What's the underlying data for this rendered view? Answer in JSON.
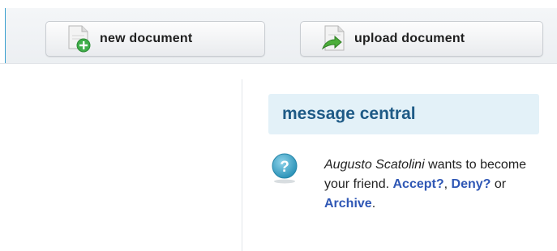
{
  "toolbar": {
    "new_document_label": "new document",
    "new_document_icon": "new-document-icon",
    "upload_document_label": "upload document",
    "upload_document_icon": "upload-document-icon"
  },
  "message_central": {
    "title": "message central",
    "messages": [
      {
        "icon": "question-icon",
        "sender": "Augusto Scatolini",
        "text": "wants to become your friend.",
        "actions": {
          "accept": "Accept?",
          "deny": "Deny?",
          "archive": "Archive"
        },
        "separator_comma": ",",
        "separator_or": "or",
        "end_period": "."
      }
    ]
  },
  "colors": {
    "toolbar_bg": "#eceff2",
    "header_bg": "#e3f1f8",
    "title": "#1e5a86",
    "link": "#2f57b5",
    "accent": "#3aa0cf"
  }
}
